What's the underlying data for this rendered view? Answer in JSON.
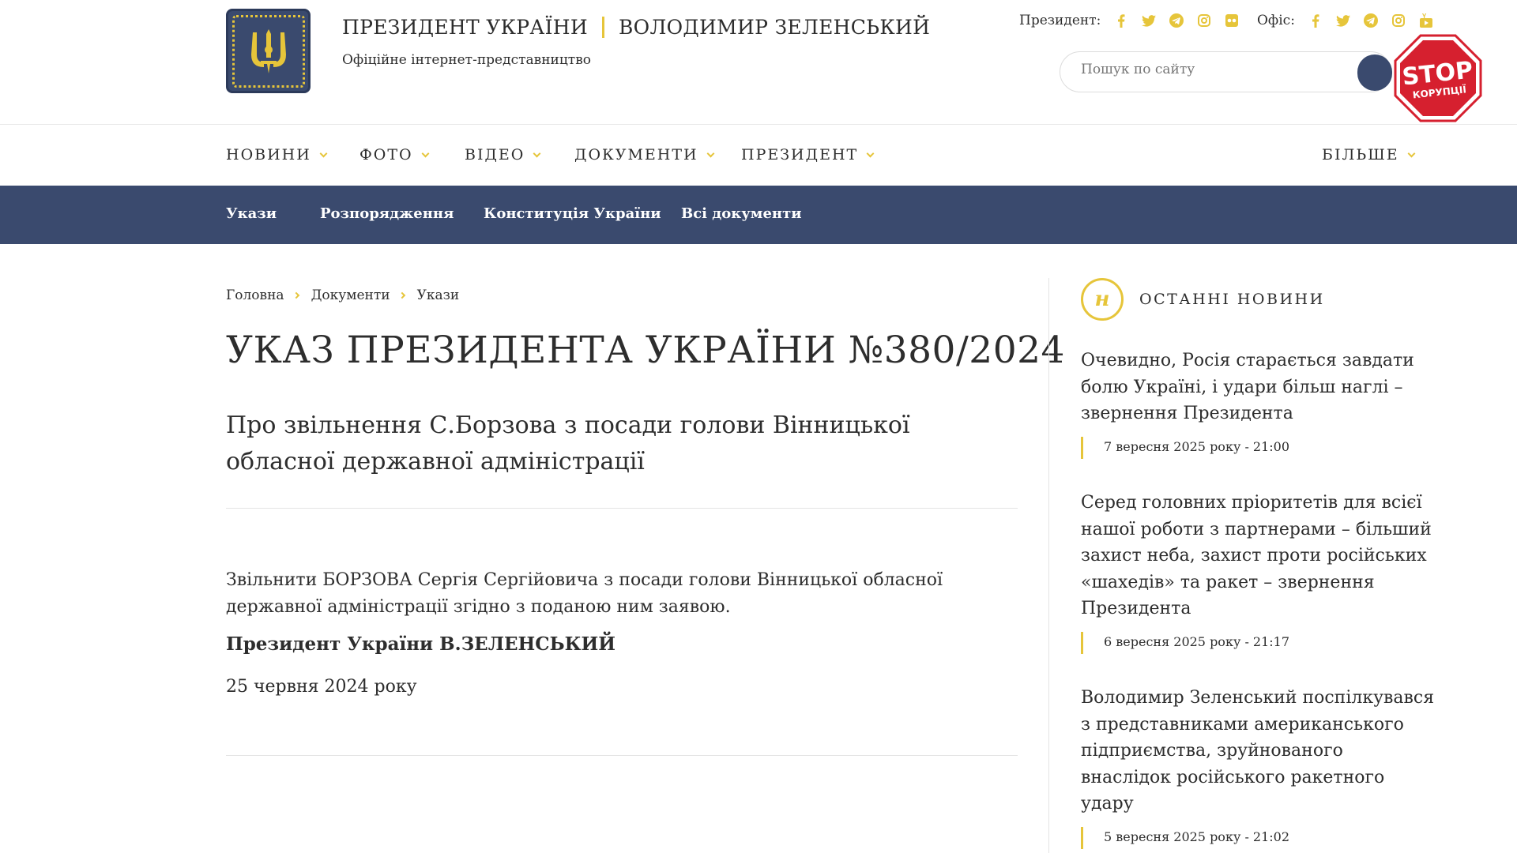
{
  "colors": {
    "accent": "#e6c53a",
    "navy": "#3a4a6e",
    "text": "#2d2d2d",
    "stop_red": "#d6202f"
  },
  "header": {
    "logo_icon": "trident-coat-of-arms-icon",
    "title_left": "ПРЕЗИДЕНТ УКРАЇНИ",
    "title_right": "ВОЛОДИМИР ЗЕЛЕНСЬКИЙ",
    "subtitle": "Офіційне інтернет-представництво",
    "president_label": "Президент:",
    "office_label": "Офіс:",
    "president_socials": [
      "facebook-icon",
      "twitter-icon",
      "telegram-icon",
      "instagram-icon",
      "flickr-icon"
    ],
    "office_socials": [
      "facebook-icon",
      "twitter-icon",
      "telegram-icon",
      "instagram-icon",
      "youtube-icon"
    ],
    "search_placeholder": "Пошук по сайту",
    "stop_badge": {
      "line1": "STOP",
      "line2": "КОРУПЦІЇ"
    }
  },
  "main_nav": {
    "items": [
      "НОВИНИ",
      "ФОТО",
      "ВІДЕО",
      "ДОКУМЕНТИ",
      "ПРЕЗИДЕНТ"
    ],
    "more": "БІЛЬШЕ"
  },
  "sub_nav": {
    "items": [
      "Укази",
      "Розпорядження",
      "Конституція України",
      "Всі документи"
    ]
  },
  "breadcrumb": [
    "Головна",
    "Документи",
    "Укази"
  ],
  "decree": {
    "title": "УКАЗ ПРЕЗИДЕНТА УКРАЇНИ №380/2024",
    "subtitle": "Про звільнення С.Борзова з посади голови Вінницької обласної державної адміністрації",
    "text": "Звільнити БОРЗОВА Сергія Сергійовича з посади голови Вінницької обласної державної адміністрації згідно з поданою ним заявою.",
    "signature": "Президент України В.ЗЕЛЕНСЬКИЙ",
    "date": "25 червня 2024 року"
  },
  "sidebar": {
    "logo_letter": "н",
    "heading": "ОСТАННІ НОВИНИ",
    "news": [
      {
        "title": "Очевидно, Росія старається завдати болю Україні, і удари більш наглі – звернення Президента",
        "date": "7 вересня 2025 року - 21:00"
      },
      {
        "title": "Серед головних пріоритетів для всієї нашої роботи з партнерами – більший захист неба, захист проти російських «шахедів» та ракет – звернення Президента",
        "date": "6 вересня 2025 року - 21:17"
      },
      {
        "title": "Володимир Зеленський поспілкувався з представниками американського підприємства, зруйнованого внаслідок російського ракетного удару",
        "date": "5 вересня 2025 року - 21:02"
      }
    ]
  }
}
